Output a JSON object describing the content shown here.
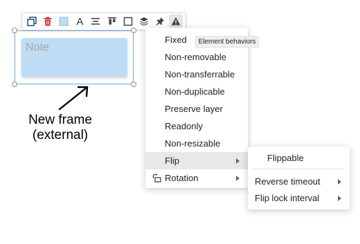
{
  "toolbar": {
    "buttons": [
      {
        "name": "duplicate-icon"
      },
      {
        "name": "delete-icon"
      },
      {
        "name": "fill-color-icon"
      },
      {
        "name": "text-format-icon",
        "glyph": "A"
      },
      {
        "name": "align-center-icon"
      },
      {
        "name": "align-top-icon"
      },
      {
        "name": "border-icon"
      },
      {
        "name": "layers-icon"
      },
      {
        "name": "pin-icon"
      },
      {
        "name": "warning-icon"
      }
    ],
    "tooltip": "Element behaviors"
  },
  "note": {
    "text": "Note",
    "fill_color": "#bfdcf5"
  },
  "annotation": {
    "line1": "New frame",
    "line2": "(external)"
  },
  "behaviors_menu": {
    "items": [
      {
        "label": "Fixed"
      },
      {
        "label": "Non-removable"
      },
      {
        "label": "Non-transferrable"
      },
      {
        "label": "Non-duplicable"
      },
      {
        "label": "Preserve layer"
      },
      {
        "label": "Readonly"
      },
      {
        "label": "Non-resizable"
      },
      {
        "label": "Flip",
        "submenu": true,
        "highlighted": true
      },
      {
        "label": "Rotation",
        "submenu": true,
        "icon": "rotation-icon"
      }
    ]
  },
  "flip_submenu": {
    "items": [
      {
        "label": "Flippable"
      },
      {
        "label": "Reverse timeout",
        "submenu": true
      },
      {
        "label": "Flip lock interval",
        "submenu": true
      }
    ]
  },
  "colors": {
    "delete": "#d0312d",
    "selection": "#7aa6d6",
    "highlight": "#e8e8e8"
  }
}
